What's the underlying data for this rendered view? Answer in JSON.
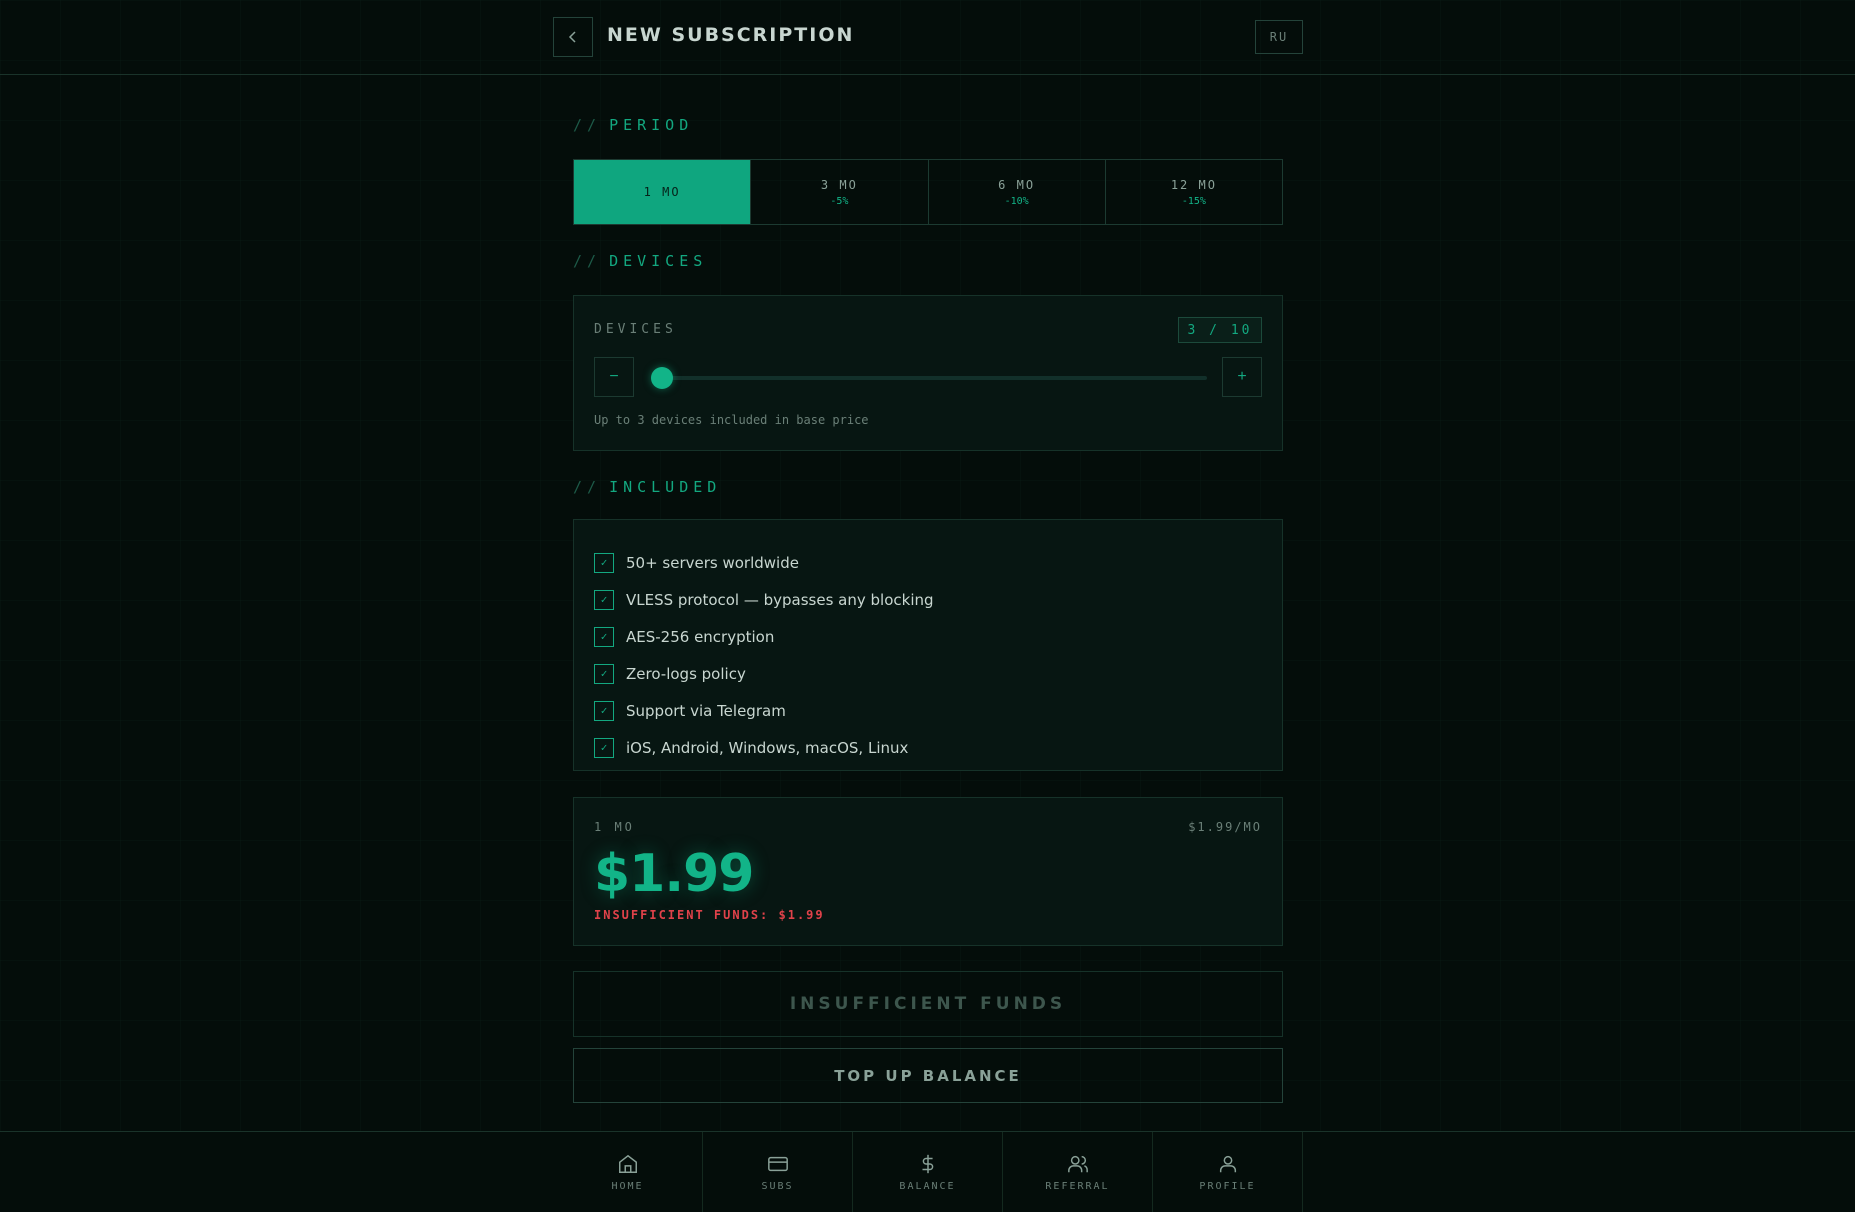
{
  "header": {
    "title": "NEW SUBSCRIPTION",
    "lang": "RU"
  },
  "sections": {
    "period": "PERIOD",
    "devices": "DEVICES",
    "included": "INCLUDED",
    "prefix": "//"
  },
  "period_tabs": [
    {
      "label": "1 MO",
      "discount": "",
      "active": true
    },
    {
      "label": "3 MO",
      "discount": "-5%",
      "active": false
    },
    {
      "label": "6 MO",
      "discount": "-10%",
      "active": false
    },
    {
      "label": "12 MO",
      "discount": "-15%",
      "active": false
    }
  ],
  "devices": {
    "label": "DEVICES",
    "count": "3 / 10",
    "value": 3,
    "min": 3,
    "max": 10,
    "minus": "−",
    "plus": "+",
    "hint": "Up to 3 devices included in base price"
  },
  "features": [
    "50+ servers worldwide",
    "VLESS protocol — bypasses any blocking",
    "AES-256 encryption",
    "Zero-logs policy",
    "Support via Telegram",
    "iOS, Android, Windows, macOS, Linux"
  ],
  "price": {
    "period": "1 MO",
    "rate": "$1.99/MO",
    "amount": "$1.99",
    "warning": "INSUFFICIENT FUNDS: $1.99"
  },
  "buttons": {
    "insufficient": "INSUFFICIENT FUNDS",
    "topup": "TOP UP BALANCE"
  },
  "nav": [
    {
      "label": "HOME",
      "icon": "home-icon"
    },
    {
      "label": "SUBS",
      "icon": "card-icon"
    },
    {
      "label": "BALANCE",
      "icon": "dollar-icon"
    },
    {
      "label": "REFERRAL",
      "icon": "users-icon"
    },
    {
      "label": "PROFILE",
      "icon": "user-icon"
    }
  ],
  "colors": {
    "accent": "#12b488",
    "background": "#040d0a",
    "warning": "#e0424a"
  }
}
